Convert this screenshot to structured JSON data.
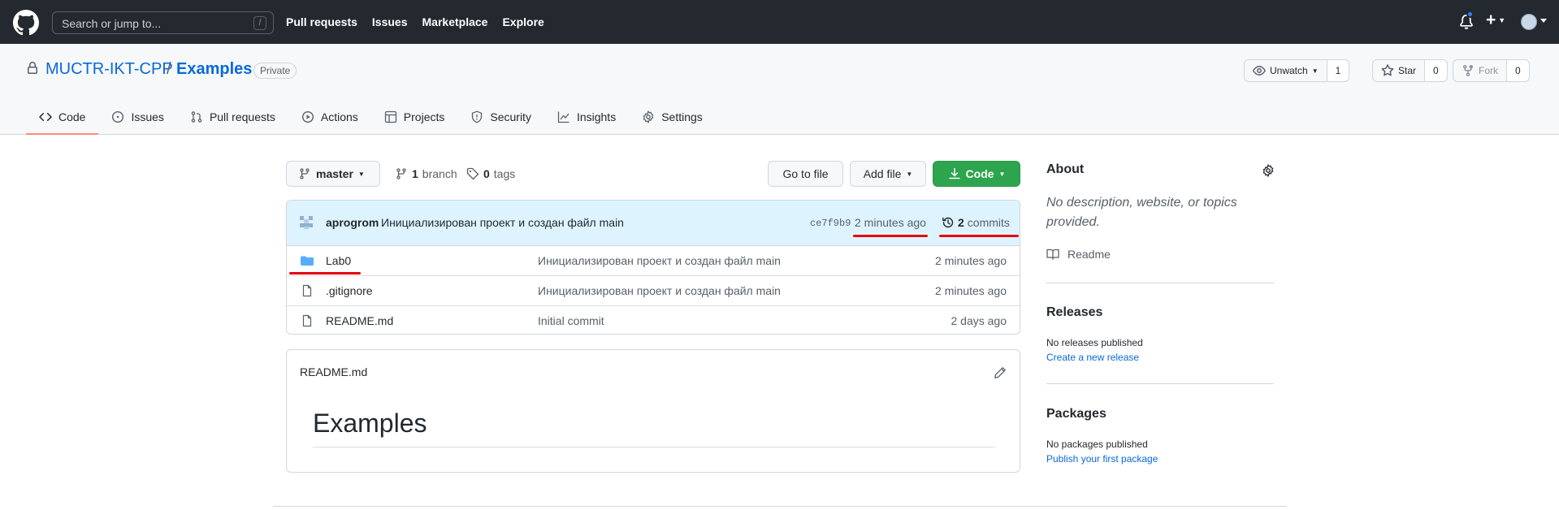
{
  "header": {
    "search_placeholder": "Search or jump to...",
    "search_key": "/",
    "nav": [
      "Pull requests",
      "Issues",
      "Marketplace",
      "Explore"
    ]
  },
  "repo": {
    "owner": "MUCTR-IKT-CPP",
    "separator": "/",
    "name": "Examples",
    "visibility": "Private",
    "unwatch_label": "Unwatch",
    "watch_count": "1",
    "star_label": "Star",
    "star_count": "0",
    "fork_label": "Fork",
    "fork_count": "0"
  },
  "tabs": [
    {
      "label": "Code",
      "icon": "code-icon"
    },
    {
      "label": "Issues",
      "icon": "issue-icon"
    },
    {
      "label": "Pull requests",
      "icon": "pull-request-icon"
    },
    {
      "label": "Actions",
      "icon": "play-icon"
    },
    {
      "label": "Projects",
      "icon": "table-icon"
    },
    {
      "label": "Security",
      "icon": "shield-icon"
    },
    {
      "label": "Insights",
      "icon": "graph-icon"
    },
    {
      "label": "Settings",
      "icon": "gear-icon"
    }
  ],
  "toolbar": {
    "branch": "master",
    "branch_count": "1",
    "branch_label": "branch",
    "tag_count": "0",
    "tag_label": "tags",
    "go_to_file": "Go to file",
    "add_file": "Add file",
    "code": "Code"
  },
  "commit": {
    "author": "aprogrom",
    "message": "Инициализирован проект и создан файл main",
    "sha": "ce7f9b9",
    "time": "2 minutes ago",
    "count": "2",
    "count_label": "commits"
  },
  "files": [
    {
      "name": "Lab0",
      "type": "folder",
      "message": "Инициализирован проект и создан файл main",
      "age": "2 minutes ago"
    },
    {
      "name": ".gitignore",
      "type": "file",
      "message": "Инициализирован проект и создан файл main",
      "age": "2 minutes ago"
    },
    {
      "name": "README.md",
      "type": "file",
      "message": "Initial commit",
      "age": "2 days ago"
    }
  ],
  "readme": {
    "filename": "README.md",
    "heading": "Examples"
  },
  "sidebar": {
    "about_title": "About",
    "about_desc": "No description, website, or topics provided.",
    "readme_label": "Readme",
    "releases_title": "Releases",
    "releases_text": "No releases published",
    "releases_link": "Create a new release",
    "packages_title": "Packages",
    "packages_text": "No packages published",
    "packages_link": "Publish your first package"
  },
  "colors": {
    "header_bg": "#24292f",
    "link": "#0969da",
    "code_button": "#2da44e",
    "active_tab": "#fd8c73",
    "annotation_red": "#e8000d"
  }
}
